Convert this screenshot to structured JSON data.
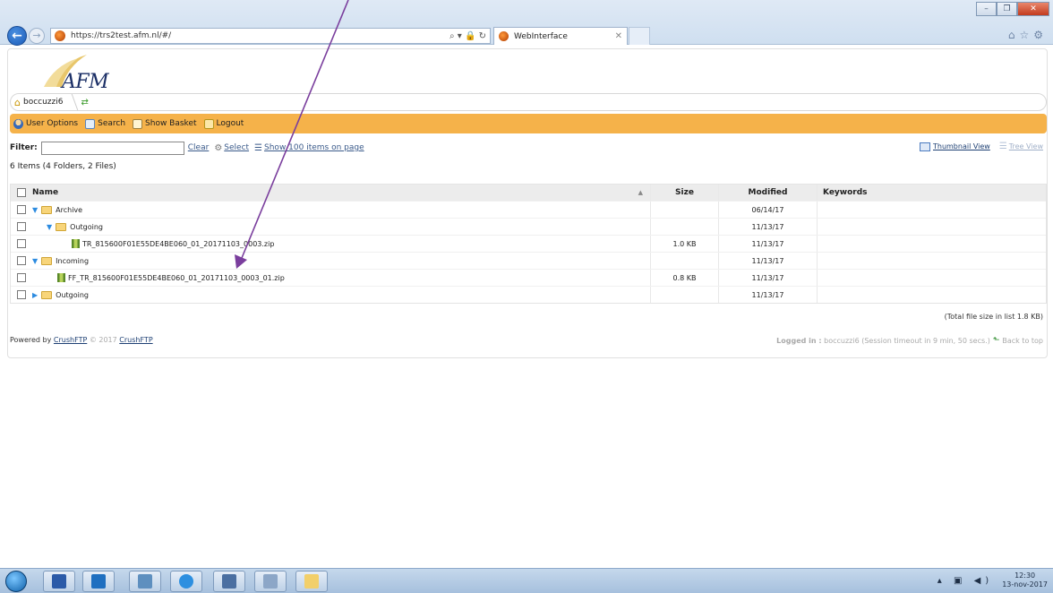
{
  "browser": {
    "url": "https://trs2test.afm.nl/#/",
    "url_host_bold": "afm.nl",
    "tab_title": "WebInterface",
    "address_tools": "⌕ ▾ 🔒 ↻"
  },
  "header": {
    "logo_text": "AFM",
    "breadcrumb_user": "boccuzzi6"
  },
  "toolbar": {
    "user_options": "User Options",
    "search": "Search",
    "show_basket": "Show Basket",
    "logout": "Logout",
    "accent_color": "#f5b24a"
  },
  "filter": {
    "label": "Filter:",
    "value": "",
    "clear": "Clear",
    "select": "Select",
    "show_items": "Show 100 items on page",
    "thumbnail_view": "Thumbnail View",
    "tree_view": "Tree View"
  },
  "summary": "6 Items (4 Folders, 2 Files)",
  "table": {
    "columns": {
      "name": "Name",
      "size": "Size",
      "modified": "Modified",
      "keywords": "Keywords"
    },
    "rows": [
      {
        "type": "folder",
        "indent": 0,
        "expanded": true,
        "name": "Archive",
        "size": "",
        "modified": "06/14/17"
      },
      {
        "type": "folder",
        "indent": 1,
        "expanded": true,
        "name": "Outgoing",
        "size": "",
        "modified": "11/13/17"
      },
      {
        "type": "file",
        "indent": 2,
        "name": "TR_815600F01E55DE4BE060_01_20171103_0003.zip",
        "size": "1.0 KB",
        "modified": "11/13/17"
      },
      {
        "type": "folder",
        "indent": 0,
        "expanded": true,
        "name": "Incoming",
        "size": "",
        "modified": "11/13/17"
      },
      {
        "type": "file",
        "indent": 1,
        "name": "FF_TR_815600F01E55DE4BE060_01_20171103_0003_01.zip",
        "size": "0.8 KB",
        "modified": "11/13/17"
      },
      {
        "type": "folder",
        "indent": 0,
        "expanded": false,
        "name": "Outgoing",
        "size": "",
        "modified": "11/13/17"
      }
    ]
  },
  "total_size": "(Total file size in list 1.8 KB)",
  "footer": {
    "powered_by": "Powered by",
    "crushftp": "CrushFTP",
    "copyright": "© 2017",
    "crushftp2": "CrushFTP",
    "logged_in_label": "Logged in :",
    "logged_in_text": "boccuzzi6 (Session timeout in 9 min, 50 secs.)",
    "back_to_top": "Back to top"
  },
  "taskbar": {
    "time": "12:30",
    "date": "13-nov-2017"
  }
}
